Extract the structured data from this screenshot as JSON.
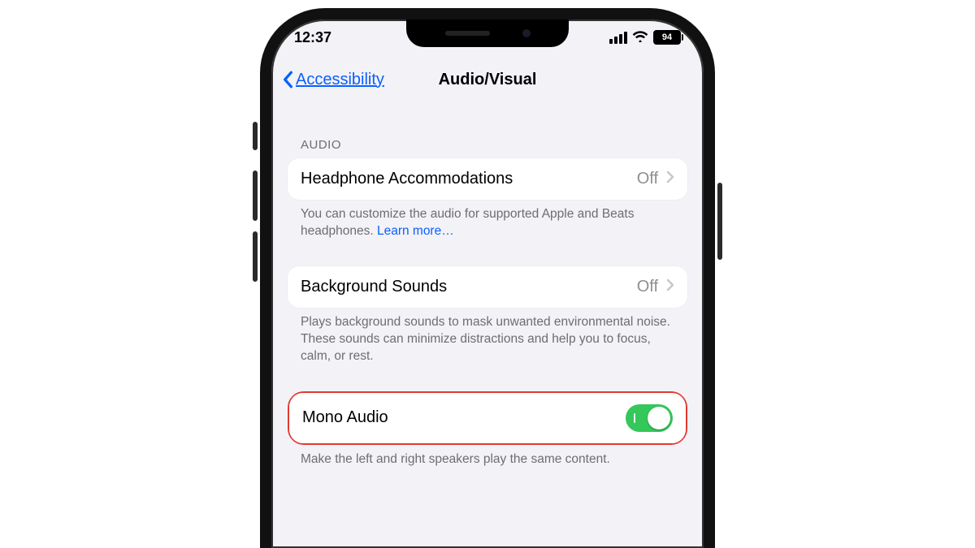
{
  "status": {
    "time": "12:37",
    "battery_pct": "94"
  },
  "nav": {
    "back_label": "Accessibility",
    "title": "Audio/Visual"
  },
  "section_audio_label": "AUDIO",
  "rows": {
    "headphone": {
      "label": "Headphone Accommodations",
      "value": "Off",
      "footer_a": "You can customize the audio for supported Apple and Beats headphones. ",
      "footer_link": "Learn more…"
    },
    "background_sounds": {
      "label": "Background Sounds",
      "value": "Off",
      "footer": "Plays background sounds to mask unwanted environmental noise. These sounds can minimize distractions and help you to focus, calm, or rest."
    },
    "mono_audio": {
      "label": "Mono Audio",
      "state": "on",
      "footer": "Make the left and right speakers play the same content."
    }
  }
}
